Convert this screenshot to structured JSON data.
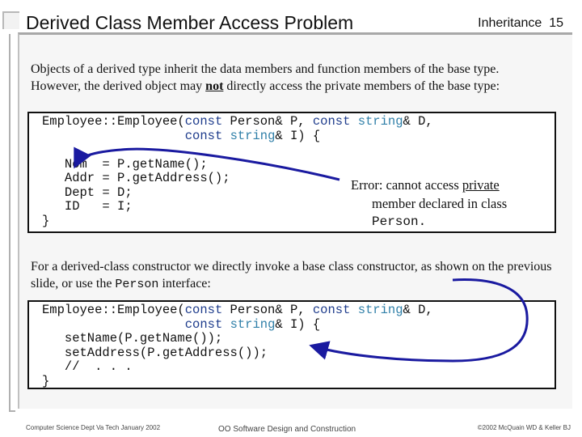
{
  "header": {
    "title": "Derived Class Member Access Problem",
    "section": "Inheritance",
    "slide_number": "15"
  },
  "intro": {
    "text_before": "Objects of a derived type inherit the data members and function members of the base type.  However, the derived object may ",
    "emphasis": "not",
    "text_after": " directly access the private members of the base type:"
  },
  "code_block_1": {
    "line1_prefix": "Employee::Employee(",
    "line1_kw1": "const",
    "line1_mid": " Person& P, ",
    "line1_kw2": "const",
    "line1_type": "string",
    "line1_end": "& D,",
    "line2_indent": "                   ",
    "line2_kw": "const",
    "line2_type": "string",
    "line2_end": "& I) {",
    "body_lines": [
      "   Nom  = P.getName();",
      "   Addr = P.getAddress();",
      "   Dept = D;",
      "   ID   = I;"
    ],
    "closing": "}"
  },
  "error_note": {
    "line1_prefix": "Error:  cannot access ",
    "line1_emphasis": "private",
    "line2": "member declared in class",
    "line3": "Person."
  },
  "second_para": {
    "text_before": "For a derived-class constructor we directly invoke a base class constructor, as shown on the previous slide, or use the ",
    "code_word": "Person",
    "text_after": " interface:"
  },
  "code_block_2": {
    "line1_prefix": "Employee::Employee(",
    "line1_kw1": "const",
    "line1_mid": " Person& P, ",
    "line1_kw2": "const",
    "line1_type": "string",
    "line1_end": "& D,",
    "line2_indent": "                   ",
    "line2_kw": "const",
    "line2_type": "string",
    "line2_end": "& I) {",
    "body_lines": [
      "   setName(P.getName());",
      "   setAddress(P.getAddress());",
      "   //  . . ."
    ],
    "closing": "}"
  },
  "footer": {
    "left": "Computer Science Dept Va Tech January 2002",
    "center": "OO Software Design and Construction",
    "right": "©2002  McQuain WD & Keller BJ"
  },
  "colors": {
    "arrow": "#1a1aa0",
    "keyword": "#1e3c8c",
    "type": "#2f7fa8"
  }
}
